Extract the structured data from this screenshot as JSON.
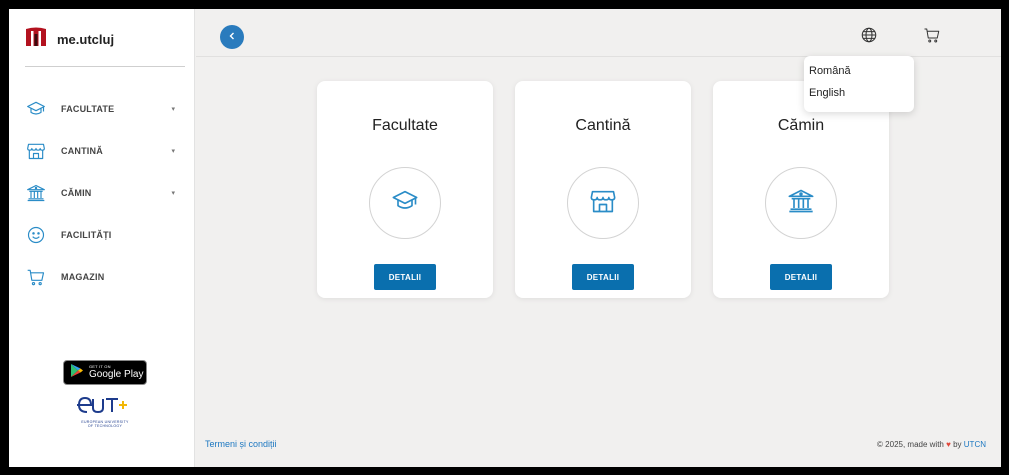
{
  "brand": {
    "name": "me.utcluj"
  },
  "sidebar": {
    "items": [
      {
        "label": "FACULTATE",
        "icon": "graduation-cap-icon",
        "has_caret": true
      },
      {
        "label": "CANTINĂ",
        "icon": "storefront-icon",
        "has_caret": true
      },
      {
        "label": "CĂMIN",
        "icon": "institution-icon",
        "has_caret": true
      },
      {
        "label": "FACILITĂȚI",
        "icon": "smiley-icon",
        "has_caret": false
      },
      {
        "label": "MAGAZIN",
        "icon": "cart-icon",
        "has_caret": false
      }
    ],
    "caret": "▾",
    "google_play": {
      "small": "GET IT ON",
      "big": "Google Play"
    },
    "eut": {
      "logo_text": "eut+",
      "caption_line1": "EUROPEAN UNIVERSITY",
      "caption_line2": "OF TECHNOLOGY"
    }
  },
  "header": {
    "icons": [
      "back-chevron-icon",
      "globe-icon",
      "cart-icon"
    ]
  },
  "language_menu": {
    "options": [
      "Română",
      "English"
    ]
  },
  "cards": [
    {
      "title": "Facultate",
      "icon": "graduation-cap-icon",
      "button": "DETALII"
    },
    {
      "title": "Cantină",
      "icon": "storefront-icon",
      "button": "DETALII"
    },
    {
      "title": "Cămin",
      "icon": "institution-icon",
      "button": "DETALII"
    }
  ],
  "footer": {
    "terms": "Termeni și condiții",
    "copyright_prefix": "© 2025, made with",
    "heart": "♥",
    "by": "by",
    "org": "UTCN"
  },
  "colors": {
    "accent": "#0a6fae",
    "back_button": "#2a7bbd",
    "icon_blue": "#2a8cc7",
    "brand_red": "#b3121f",
    "link": "#1d78c1"
  }
}
